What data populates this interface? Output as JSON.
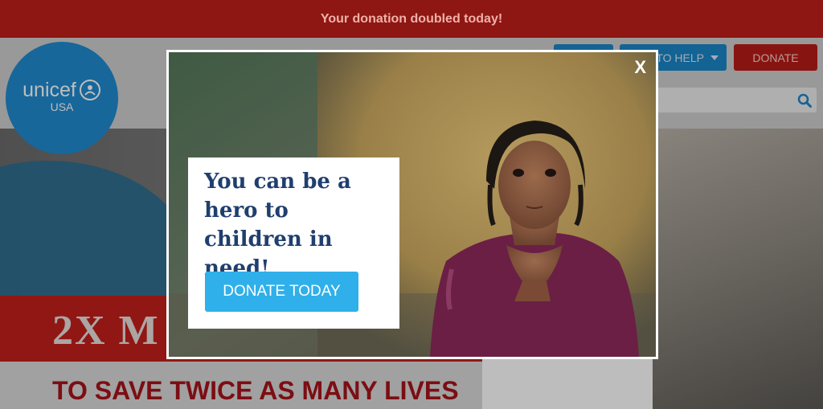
{
  "announcement": "Your donation doubled today!",
  "logo": {
    "name": "unicef",
    "region": "USA"
  },
  "nav": {
    "ways_to_help": "TO HELP",
    "donate": "DONATE"
  },
  "hero": {
    "headline": "2X M",
    "subhead": "TO SAVE TWICE AS MANY LIVES"
  },
  "modal": {
    "close": "X",
    "headline": "You can be a hero to children in need!",
    "cta": "DONATE TODAY"
  },
  "colors": {
    "brand_blue": "#1f8bd1",
    "cta_blue": "#2fb0ea",
    "brand_red": "#c4201c",
    "headline_navy": "#1f3f6e"
  },
  "icons": [
    "unicef-emblem-icon",
    "search-icon",
    "caret-down-icon",
    "close-icon"
  ]
}
